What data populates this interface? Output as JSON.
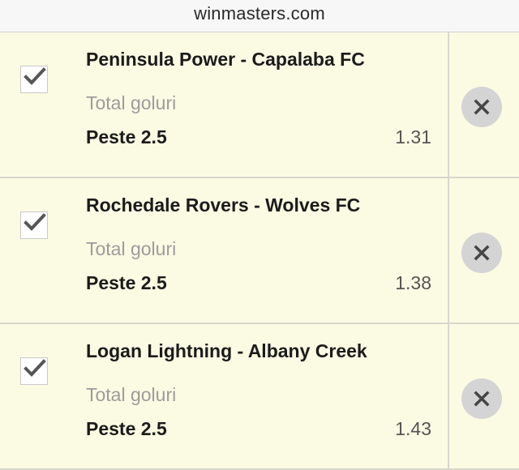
{
  "header": {
    "domain": "winmasters.com"
  },
  "bets": [
    {
      "match": "Peninsula Power - Capalaba FC",
      "market": "Total goluri",
      "selection": "Peste 2.5",
      "odds": "1.31",
      "checked": true
    },
    {
      "match": "Rochedale Rovers - Wolves FC",
      "market": "Total goluri",
      "selection": "Peste 2.5",
      "odds": "1.38",
      "checked": true
    },
    {
      "match": "Logan Lightning - Albany Creek",
      "market": "Total goluri",
      "selection": "Peste 2.5",
      "odds": "1.43",
      "checked": true
    }
  ],
  "icons": {
    "checkbox": "check-icon",
    "remove": "close-icon"
  },
  "colors": {
    "background": "#fbfbe4",
    "topbar": "#f7f7f7",
    "remove_button": "#d4d4d4",
    "muted_text": "#9c9c9c"
  }
}
